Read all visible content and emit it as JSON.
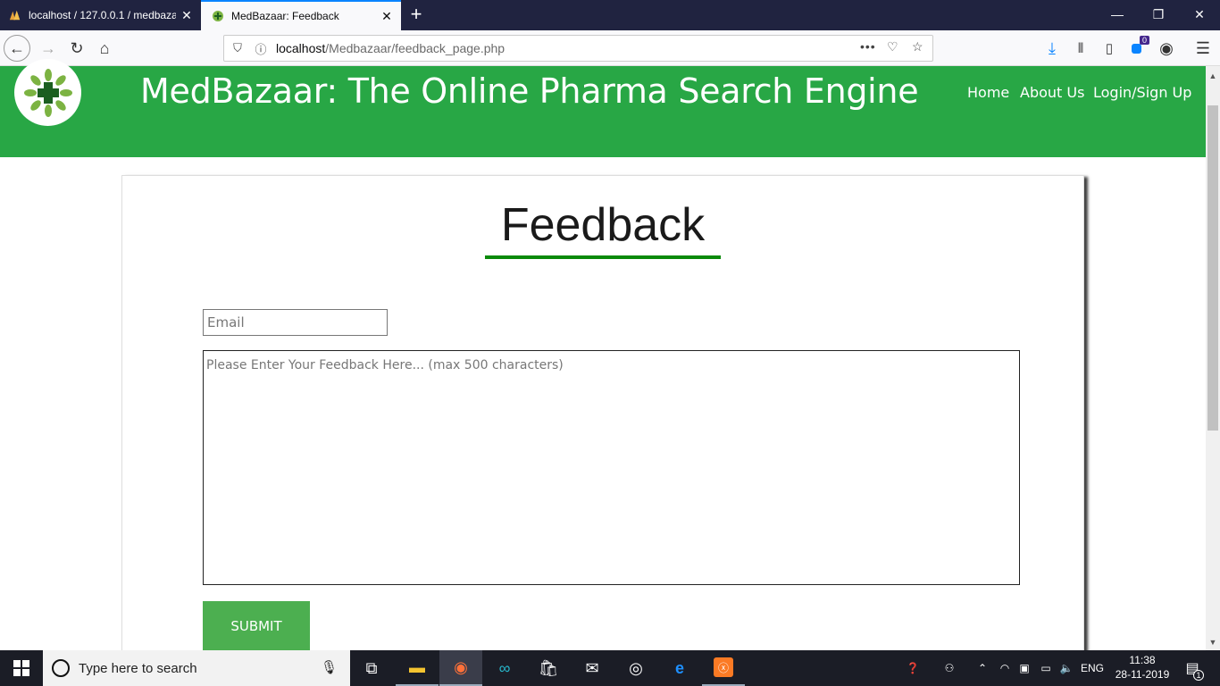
{
  "browser": {
    "tabs": [
      {
        "title": "localhost / 127.0.0.1 / medbaza",
        "active": false
      },
      {
        "title": "MedBazaar: Feedback",
        "active": true
      }
    ],
    "url_host": "localhost",
    "url_path": "/Medbazaar/feedback_page.php",
    "url_menu": "•••",
    "container_badge": "0"
  },
  "site": {
    "title": "MedBazaar: The Online Pharma Search Engine",
    "nav": [
      "Home",
      "About Us",
      "Login/Sign Up"
    ],
    "brand_color": "#28a745"
  },
  "form": {
    "heading": "Feedback",
    "email_placeholder": "Email",
    "feedback_placeholder": "Please Enter Your Feedback Here... (max 500 characters)",
    "submit_label": "SUBMIT"
  },
  "taskbar": {
    "search_placeholder": "Type here to search",
    "language": "ENG",
    "time": "11:38",
    "date": "28-11-2019",
    "notification_count": "1"
  }
}
